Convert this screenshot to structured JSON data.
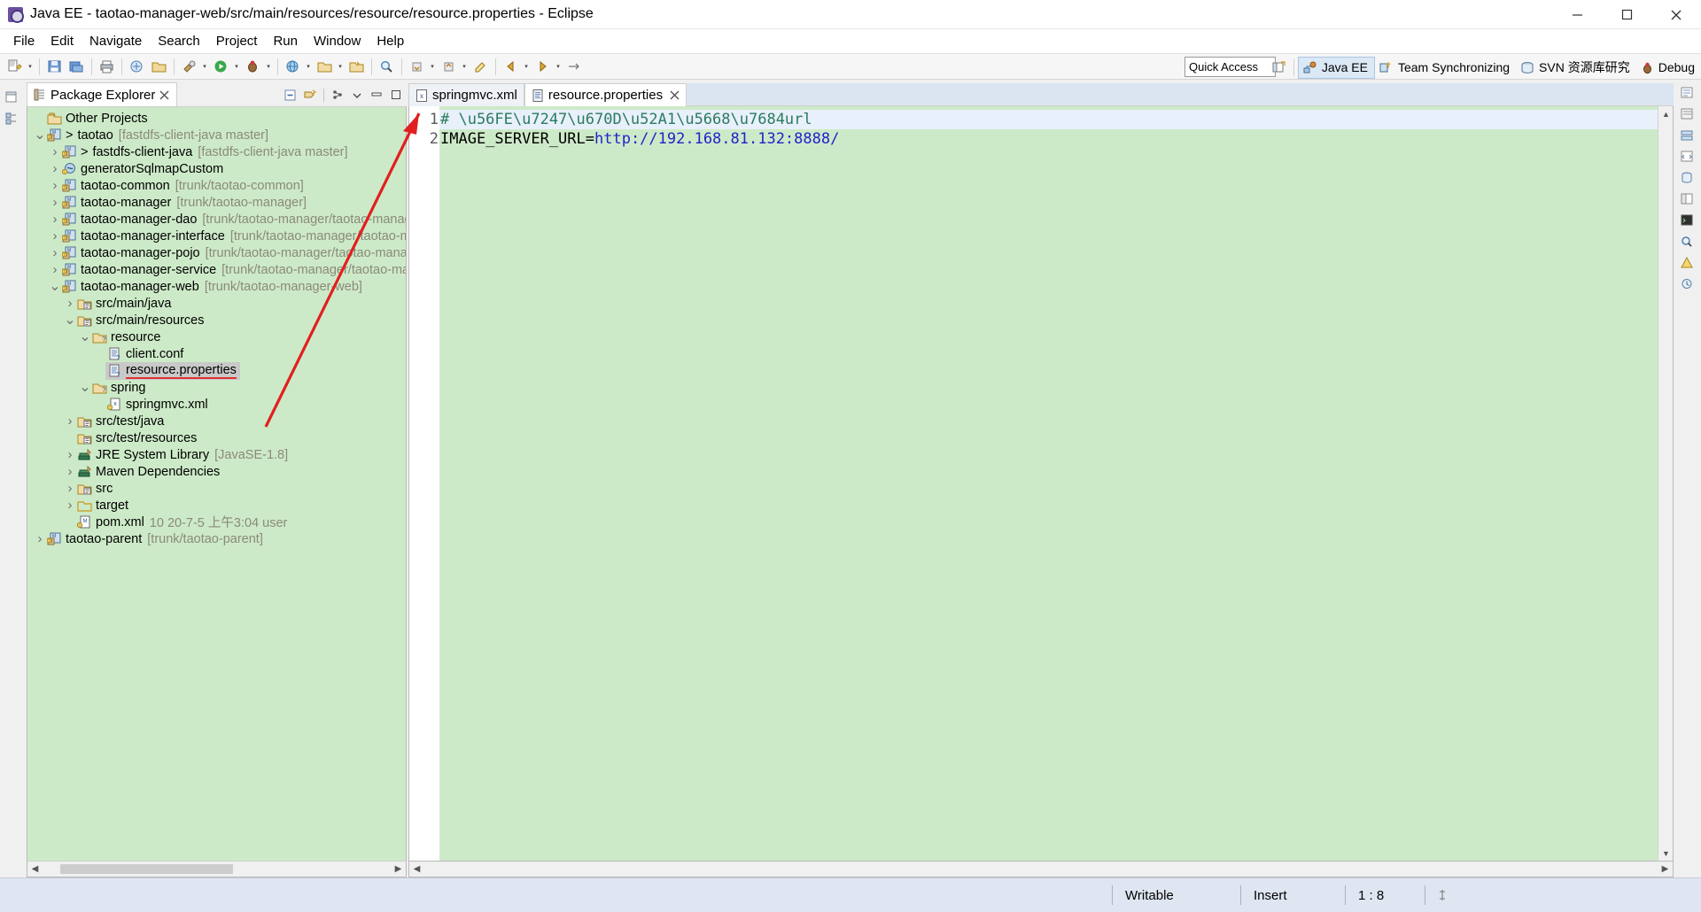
{
  "window": {
    "title": "Java EE - taotao-manager-web/src/main/resources/resource/resource.properties - Eclipse",
    "minimize_label": "─",
    "maximize_label": "☐",
    "close_label": "✕"
  },
  "menubar": {
    "items": [
      {
        "label": "File"
      },
      {
        "label": "Edit"
      },
      {
        "label": "Navigate"
      },
      {
        "label": "Search"
      },
      {
        "label": "Project"
      },
      {
        "label": "Run"
      },
      {
        "label": "Window"
      },
      {
        "label": "Help"
      }
    ]
  },
  "toolbar": {
    "quick_access_placeholder": "Quick Access",
    "quick_access_value": "Quick Access",
    "perspectives": [
      {
        "label": "Java EE",
        "icon": "java-ee-perspective-icon",
        "active": true
      },
      {
        "label": "Team Synchronizing",
        "icon": "team-sync-icon",
        "active": false
      },
      {
        "label": "SVN 资源库研究",
        "icon": "svn-repo-icon",
        "active": false
      },
      {
        "label": "Debug",
        "icon": "debug-perspective-icon",
        "active": false
      }
    ]
  },
  "package_explorer": {
    "tab_label": "Package Explorer",
    "tab_icon": "package-explorer-icon",
    "close_icon": "close-icon",
    "header_buttons": [
      {
        "name": "collapse-all-icon"
      },
      {
        "name": "link-with-editor-icon"
      },
      {
        "name": "view-menu-icon"
      },
      {
        "name": "minimize-view-icon"
      },
      {
        "name": "maximize-view-icon"
      }
    ],
    "tree": [
      {
        "indent": 0,
        "twisty": "",
        "icon": "project-closed-icon",
        "label": "Other Projects",
        "meta": "",
        "selected": false
      },
      {
        "indent": 0,
        "twisty": "v",
        "icon": "maven-project-icon",
        "label": "taotao",
        "prefix": ">",
        "meta": "[fastdfs-client-java master]",
        "selected": false
      },
      {
        "indent": 1,
        "twisty": ">",
        "icon": "maven-project-icon",
        "label": "fastdfs-client-java",
        "prefix": ">",
        "meta": "[fastdfs-client-java master]",
        "selected": false
      },
      {
        "indent": 1,
        "twisty": ">",
        "icon": "java-project-icon",
        "label": "generatorSqlmapCustom",
        "meta": "",
        "selected": false
      },
      {
        "indent": 1,
        "twisty": ">",
        "icon": "maven-project-icon",
        "label": "taotao-common",
        "meta": "[trunk/taotao-common]",
        "selected": false
      },
      {
        "indent": 1,
        "twisty": ">",
        "icon": "maven-project-icon",
        "label": "taotao-manager",
        "meta": "[trunk/taotao-manager]",
        "selected": false
      },
      {
        "indent": 1,
        "twisty": ">",
        "icon": "maven-project-icon",
        "label": "taotao-manager-dao",
        "meta": "[trunk/taotao-manager/taotao-manager-",
        "selected": false
      },
      {
        "indent": 1,
        "twisty": ">",
        "icon": "maven-project-icon",
        "label": "taotao-manager-interface",
        "meta": "[trunk/taotao-manager/taotao-mana",
        "selected": false
      },
      {
        "indent": 1,
        "twisty": ">",
        "icon": "maven-project-icon",
        "label": "taotao-manager-pojo",
        "meta": "[trunk/taotao-manager/taotao-manager",
        "selected": false
      },
      {
        "indent": 1,
        "twisty": ">",
        "icon": "maven-project-icon",
        "label": "taotao-manager-service",
        "meta": "[trunk/taotao-manager/taotao-manag",
        "selected": false
      },
      {
        "indent": 1,
        "twisty": "v",
        "icon": "maven-project-icon",
        "label": "taotao-manager-web",
        "meta": "[trunk/taotao-manager-web]",
        "selected": false
      },
      {
        "indent": 2,
        "twisty": ">",
        "icon": "source-folder-icon",
        "label": "src/main/java",
        "meta": "",
        "selected": false
      },
      {
        "indent": 2,
        "twisty": "v",
        "icon": "source-folder-icon",
        "label": "src/main/resources",
        "meta": "",
        "selected": false
      },
      {
        "indent": 3,
        "twisty": "v",
        "icon": "folder-icon",
        "label": "resource",
        "meta": "",
        "selected": false
      },
      {
        "indent": 4,
        "twisty": "",
        "icon": "file-icon",
        "label": "client.conf",
        "meta": "",
        "selected": false
      },
      {
        "indent": 4,
        "twisty": "",
        "icon": "file-icon",
        "label": "resource.properties",
        "meta": "",
        "selected": true
      },
      {
        "indent": 3,
        "twisty": "v",
        "icon": "folder-icon",
        "label": "spring",
        "meta": "",
        "selected": false
      },
      {
        "indent": 4,
        "twisty": "",
        "icon": "xml-file-icon",
        "label": "springmvc.xml",
        "meta": "",
        "selected": false
      },
      {
        "indent": 2,
        "twisty": ">",
        "icon": "source-folder-icon",
        "label": "src/test/java",
        "meta": "",
        "selected": false
      },
      {
        "indent": 2,
        "twisty": "",
        "icon": "source-folder-icon",
        "label": "src/test/resources",
        "meta": "",
        "selected": false
      },
      {
        "indent": 2,
        "twisty": ">",
        "icon": "jre-library-icon",
        "label": "JRE System Library",
        "meta": "[JavaSE-1.8]",
        "selected": false
      },
      {
        "indent": 2,
        "twisty": ">",
        "icon": "maven-library-icon",
        "label": "Maven Dependencies",
        "meta": "",
        "selected": false
      },
      {
        "indent": 2,
        "twisty": ">",
        "icon": "source-folder-icon",
        "label": "src",
        "meta": "",
        "selected": false
      },
      {
        "indent": 2,
        "twisty": ">",
        "icon": "plain-folder-icon",
        "label": "target",
        "meta": "",
        "selected": false
      },
      {
        "indent": 2,
        "twisty": "",
        "icon": "pom-file-icon",
        "label": "pom.xml",
        "meta": "10  20-7-5 上午3:04  user",
        "selected": false
      },
      {
        "indent": 0,
        "twisty": ">",
        "icon": "maven-project-icon",
        "label": "taotao-parent",
        "meta": "[trunk/taotao-parent]",
        "selected": false
      }
    ],
    "hscroll_left_icon": "scroll-left-icon",
    "hscroll_right_icon": "scroll-right-icon"
  },
  "editor": {
    "tabs": [
      {
        "label": "springmvc.xml",
        "icon": "xml-file-icon",
        "active": false,
        "closable": false
      },
      {
        "label": "resource.properties",
        "icon": "properties-file-icon",
        "active": true,
        "closable": true
      }
    ],
    "close_icon": "close-icon",
    "lines": [
      {
        "number": "1",
        "kind": "comment",
        "text": "# \\u56FE\\u7247\\u670D\\u52A1\\u5668\\u7684url"
      },
      {
        "number": "2",
        "kind": "property",
        "key": "IMAGE_SERVER_URL=",
        "value": "http://192.168.81.132:8888/"
      }
    ],
    "colors": {
      "comment": "#2a7b5f",
      "value": "#2222cc",
      "current_line_bg": "#e8f0fb",
      "editor_bg": "#cdeac8"
    }
  },
  "statusbar": {
    "writable": "Writable",
    "insert_mode": "Insert",
    "cursor_position": "1 : 8",
    "smart_insert_icon": "smart-insert-icon"
  }
}
